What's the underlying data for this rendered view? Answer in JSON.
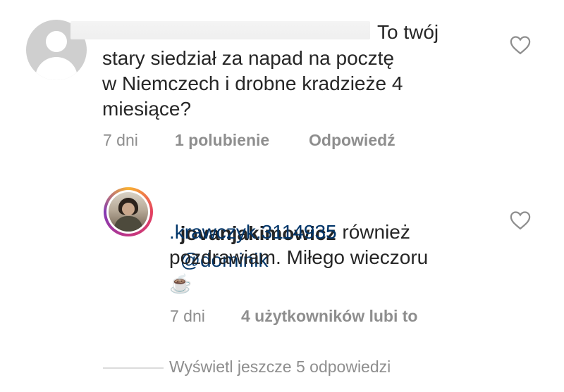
{
  "comment1": {
    "text_line1": "To twój",
    "text_line2": "stary siedział za napad na pocztę",
    "text_line3": "w Niemczech i drobne kradzieże 4",
    "text_line4": "miesiące?",
    "time": "7 dni",
    "likes": "1 polubienie",
    "reply_label": "Odpowiedź",
    "like_icon": "heart-outline-icon"
  },
  "reply1": {
    "username": "jovanjakimowicz",
    "mention_part1": "@dominik",
    "mention_part2": ".krawczyk.3114935",
    "text_after_mention": " również",
    "text_line3": "pozdrawiam. Miłego wieczoru",
    "emoji": "☕",
    "time": "7 dni",
    "likes": "4 użytkowników lubi to",
    "like_icon": "heart-outline-icon"
  },
  "view_more": "Wyświetl jeszcze 5 odpowiedzi"
}
